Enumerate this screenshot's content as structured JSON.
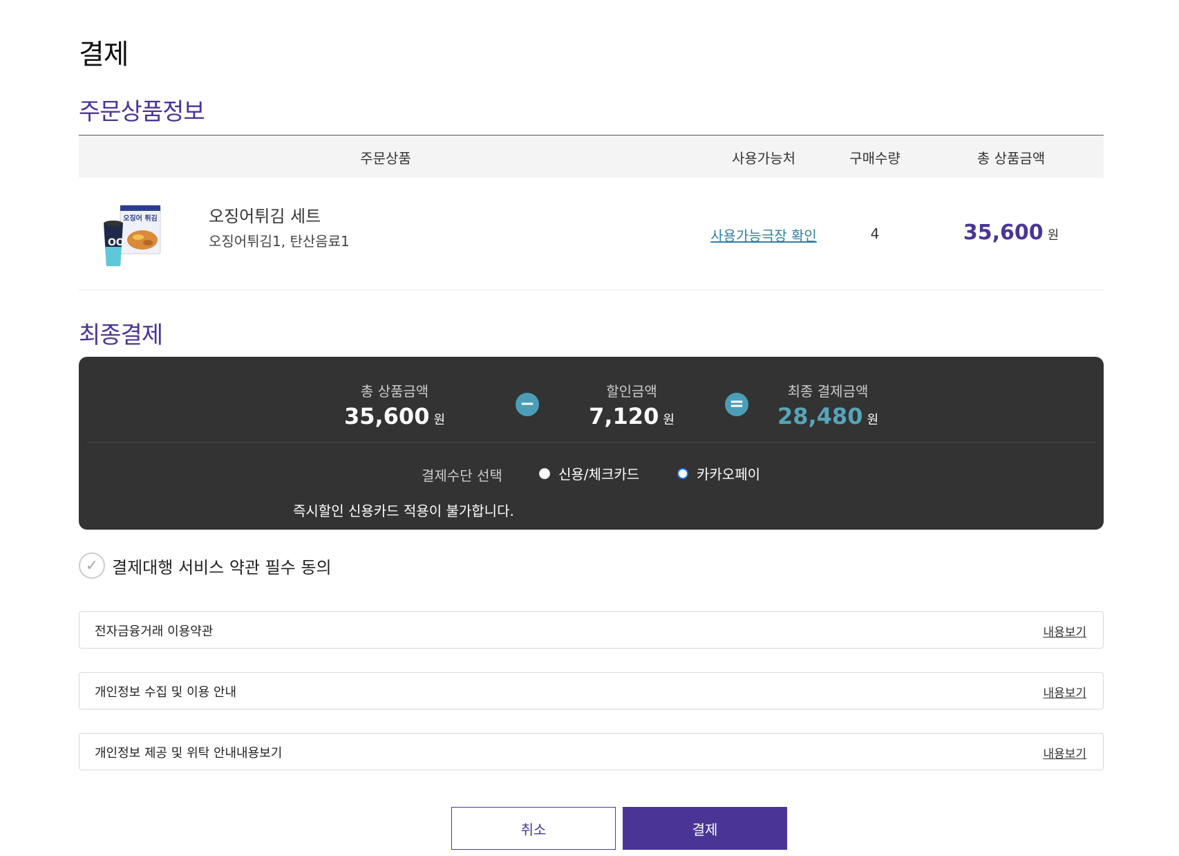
{
  "page": {
    "title": "결제"
  },
  "order": {
    "section_title": "주문상품정보",
    "headers": {
      "product": "주문상품",
      "place": "사용가능처",
      "qty": "구매수량",
      "total": "총 상품금액"
    },
    "item": {
      "name": "오징어튀김 세트",
      "desc": "오징어튀김1, 탄산음료1",
      "thumb_text": "오징어 튀김",
      "place_link": "사용가능극장 확인",
      "qty": "4",
      "total": "35,600",
      "unit": "원"
    }
  },
  "final": {
    "section_title": "최종결제",
    "total_label": "총 상품금액",
    "total_value": "35,600",
    "discount_label": "할인금액",
    "discount_value": "7,120",
    "final_label": "최종 결제금액",
    "final_value": "28,480",
    "unit": "원",
    "minus_symbol": "−",
    "equals_symbol": "=",
    "method_label": "결제수단 선택",
    "methods": [
      {
        "label": "신용/체크카드",
        "selected": false
      },
      {
        "label": "카카오페이",
        "selected": true
      }
    ],
    "notice": "즉시할인 신용카드 적용이 불가합니다."
  },
  "agreement": {
    "label": "결제대행 서비스 약관 필수 동의",
    "check_glyph": "✓",
    "terms": [
      {
        "title": "전자금융거래 이용약관",
        "link": "내용보기"
      },
      {
        "title": "개인정보 수집 및 이용 안내",
        "link": "내용보기"
      },
      {
        "title": "개인정보 제공 및 위탁 안내내용보기",
        "link": "내용보기"
      }
    ]
  },
  "buttons": {
    "cancel": "취소",
    "pay": "결제"
  },
  "colors": {
    "brand": "#4a3596",
    "accent": "#56a5ba",
    "panel": "#333333",
    "link": "#2f7ea5"
  },
  "icons": {
    "product_thumb": "popcorn-combo-image",
    "minus": "minus-circle-icon",
    "equals": "equals-circle-icon",
    "check": "check-circle-icon"
  }
}
